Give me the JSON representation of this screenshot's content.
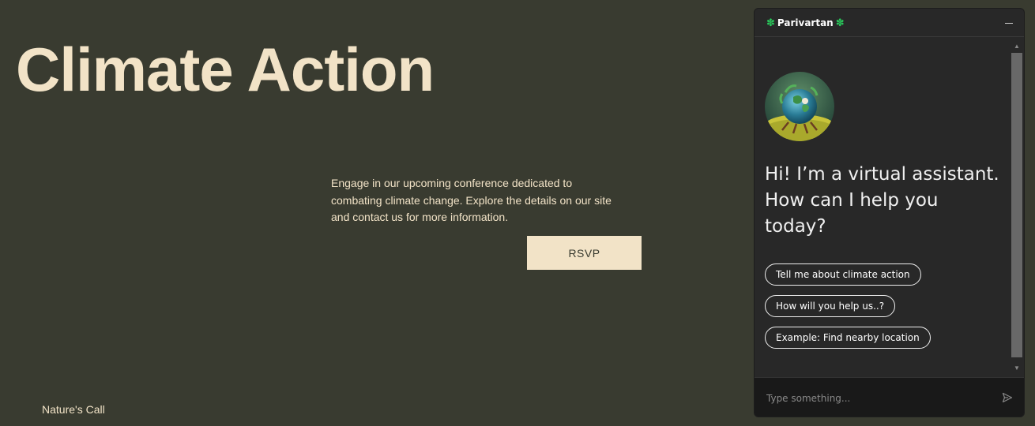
{
  "hero": {
    "title": "Climate Action",
    "description": "Engage in our upcoming conference dedicated to combating climate change. Explore the details on our site and contact us for more information.",
    "rsvp_label": "RSVP"
  },
  "footer": {
    "brand": "Nature's Call"
  },
  "chat": {
    "title": "Parivartan",
    "greeting": "Hi! I’m a virtual assistant. How can I help you today?",
    "suggestions": [
      "Tell me about climate action",
      "How will you help us..?",
      "Example: Find nearby location"
    ],
    "input_placeholder": "Type something...",
    "icons": {
      "title_decoration": "clover-icon",
      "minimize": "minimize-icon",
      "send": "send-icon",
      "avatar": "globe-avatar"
    }
  },
  "colors": {
    "background": "#393b30",
    "accent": "#f2e3c7",
    "chat_panel": "#282828",
    "clover": "#29c65a"
  }
}
